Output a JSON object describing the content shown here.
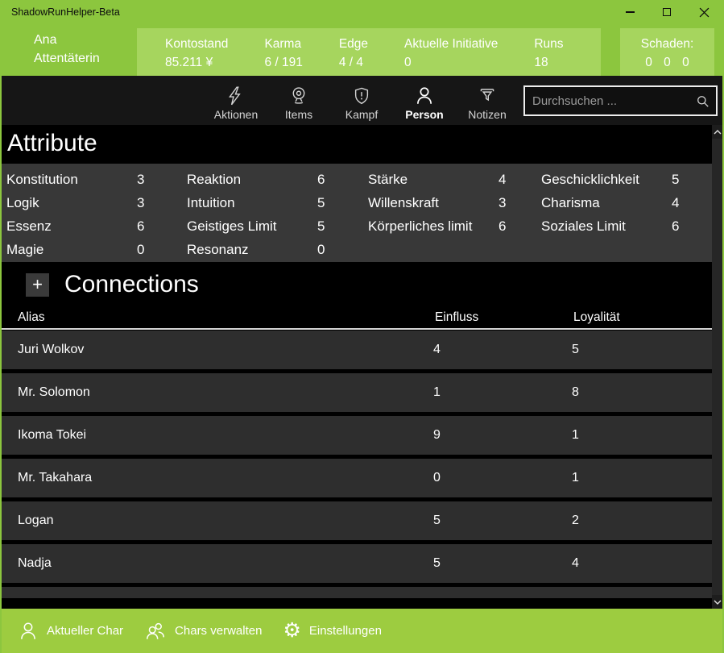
{
  "window": {
    "title": "ShadowRunHelper-Beta"
  },
  "colors": {
    "accent_green": "#8CC63E",
    "accent_green_light": "#A6D55E",
    "footer_green": "#9DCC40",
    "attr_row_gray": "#383838",
    "connection_row_gray": "#2E2E2E"
  },
  "header": {
    "char_name_line1": "Ana",
    "char_name_line2": "Attentäterin",
    "stats": [
      {
        "label": "Kontostand",
        "value": "85.211 ¥"
      },
      {
        "label": "Karma",
        "value": "6 / 191"
      },
      {
        "label": "Edge",
        "value": "4 / 4"
      },
      {
        "label": "Aktuelle Initiative",
        "value": "0"
      },
      {
        "label": "Runs",
        "value": "18"
      }
    ],
    "damage": {
      "label": "Schaden:",
      "value": "0 0 0"
    }
  },
  "nav": {
    "tabs": [
      {
        "label": "Aktionen",
        "icon": "lightning-icon"
      },
      {
        "label": "Items",
        "icon": "webcam-icon"
      },
      {
        "label": "Kampf",
        "icon": "shield-exclamation-icon"
      },
      {
        "label": "Person",
        "icon": "person-icon",
        "selected": true
      },
      {
        "label": "Notizen",
        "icon": "funnel-icon"
      }
    ],
    "search_placeholder": "Durchsuchen ..."
  },
  "attributes": {
    "title": "Attribute",
    "cells": [
      {
        "label": "Konstitution",
        "value": "3"
      },
      {
        "label": "Reaktion",
        "value": "6"
      },
      {
        "label": "Stärke",
        "value": "4"
      },
      {
        "label": "Geschicklichkeit",
        "value": "5"
      },
      {
        "label": "Logik",
        "value": "3"
      },
      {
        "label": "Intuition",
        "value": "5"
      },
      {
        "label": "Willenskraft",
        "value": "3"
      },
      {
        "label": "Charisma",
        "value": "4"
      },
      {
        "label": "Essenz",
        "value": "6"
      },
      {
        "label": "Geistiges Limit",
        "value": "5"
      },
      {
        "label": "Körperliches limit",
        "value": "6"
      },
      {
        "label": "Soziales Limit",
        "value": "6"
      },
      {
        "label": "Magie",
        "value": "0"
      },
      {
        "label": "Resonanz",
        "value": "0"
      }
    ]
  },
  "connections": {
    "title": "Connections",
    "add_button": "+",
    "columns": {
      "alias": "Alias",
      "einfluss": "Einfluss",
      "loyalitaet": "Loyalität"
    },
    "rows": [
      {
        "alias": "Juri Wolkov",
        "einfluss": "4",
        "loyalitaet": "5"
      },
      {
        "alias": "Mr. Solomon",
        "einfluss": "1",
        "loyalitaet": "8"
      },
      {
        "alias": "Ikoma Tokei",
        "einfluss": "9",
        "loyalitaet": "1"
      },
      {
        "alias": "Mr. Takahara",
        "einfluss": "0",
        "loyalitaet": "1"
      },
      {
        "alias": "Logan",
        "einfluss": "5",
        "loyalitaet": "2"
      },
      {
        "alias": "Nadja",
        "einfluss": "5",
        "loyalitaet": "4"
      }
    ]
  },
  "footer": {
    "items": [
      {
        "label": "Aktueller Char",
        "icon": "person-icon"
      },
      {
        "label": "Chars verwalten",
        "icon": "people-icon"
      },
      {
        "label": "Einstellungen",
        "icon": "gear-icon"
      }
    ]
  }
}
